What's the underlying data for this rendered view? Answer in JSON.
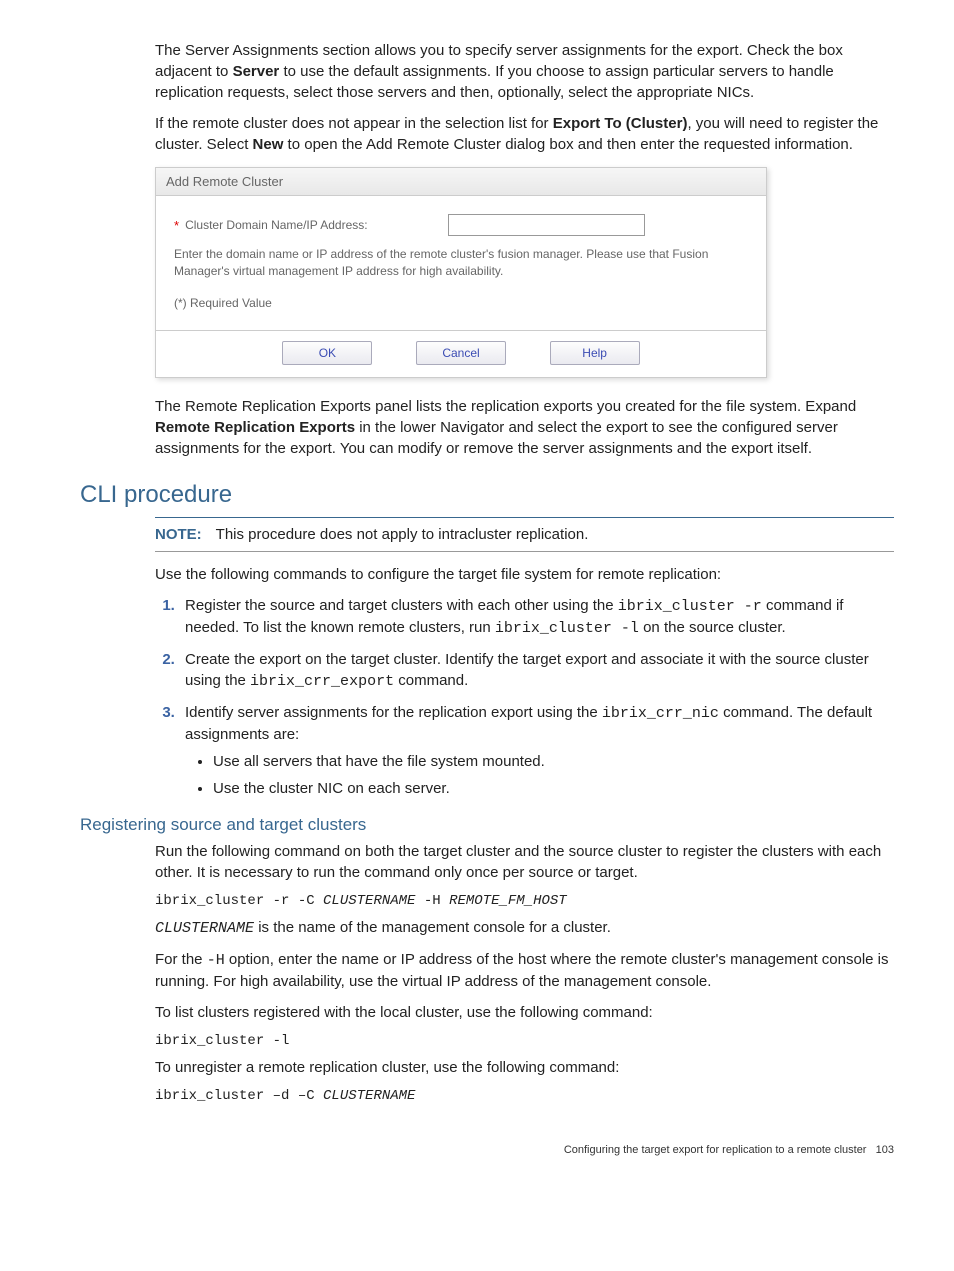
{
  "intro": {
    "p1_a": "The Server Assignments section allows you to specify server assignments for the export. Check the box adjacent to ",
    "p1_b_bold": "Server",
    "p1_c": " to use the default assignments. If you choose to assign particular servers to handle replication requests, select those servers and then, optionally, select the appropriate NICs.",
    "p2_a": "If the remote cluster does not appear in the selection list for ",
    "p2_b_bold": "Export To (Cluster)",
    "p2_c": ", you will need to register the cluster. Select ",
    "p2_d_bold": "New",
    "p2_e": " to open the Add Remote Cluster dialog box and then enter the requested information."
  },
  "dialog": {
    "title": "Add Remote Cluster",
    "field_label": "Cluster Domain Name/IP Address:",
    "helper": "Enter the domain name or IP address of the remote cluster's fusion manager. Please use that Fusion Manager's virtual management IP address for high availability.",
    "required_note": "(*) Required Value",
    "ok": "OK",
    "cancel": "Cancel",
    "help": "Help"
  },
  "after_dialog": {
    "p_a": "The Remote Replication Exports panel lists the replication exports you created for the file system. Expand ",
    "p_b_bold": "Remote Replication Exports",
    "p_c": " in the lower Navigator and select the export to see the configured server assignments for the export. You can modify or remove the server assignments and the export itself."
  },
  "cli": {
    "heading": "CLI procedure",
    "note_label": "NOTE:",
    "note_text": "This procedure does not apply to intracluster replication.",
    "lead": "Use the following commands to configure the target file system for remote replication:",
    "steps": {
      "s1_a": "Register the source and target clusters with each other using the ",
      "s1_cmd1": "ibrix_cluster -r",
      "s1_b": " command if needed. To list the known remote clusters, run ",
      "s1_cmd2": "ibrix_cluster -l",
      "s1_c": " on the source cluster.",
      "s2_a": "Create the export on the target cluster. Identify the target export and associate it with the source cluster using the ",
      "s2_cmd": "ibrix_crr_export",
      "s2_b": " command.",
      "s3_a": "Identify server assignments for the replication export using the ",
      "s3_cmd": "ibrix_crr_nic",
      "s3_b": " command. The default assignments are:",
      "s3_bullet1": "Use all servers that have the file system mounted.",
      "s3_bullet2": "Use the cluster NIC on each server."
    }
  },
  "registering": {
    "heading": "Registering source and target clusters",
    "p1": "Run the following command on both the target cluster and the source cluster to register the clusters with each other. It is necessary to run the command only once per source or target.",
    "cmd1_a": "ibrix_cluster -r -C ",
    "cmd1_b": "CLUSTERNAME",
    "cmd1_c": " -H ",
    "cmd1_d": "REMOTE_FM_HOST",
    "p2_a": "CLUSTERNAME",
    "p2_b": " is the name of the management console for a cluster.",
    "p3_a": "For the ",
    "p3_cmd": "-H",
    "p3_b": " option, enter the name or IP address of the host where the remote cluster's management console is running. For high availability, use the virtual IP address of the management console.",
    "p4": "To list clusters registered with the local cluster, use the following command:",
    "cmd2": "ibrix_cluster -l",
    "p5": "To unregister a remote replication cluster, use the following command:",
    "cmd3_a": "ibrix_cluster –d –C ",
    "cmd3_b": "CLUSTERNAME"
  },
  "footer": {
    "text": "Configuring the target export for replication to a remote cluster",
    "page": "103"
  }
}
